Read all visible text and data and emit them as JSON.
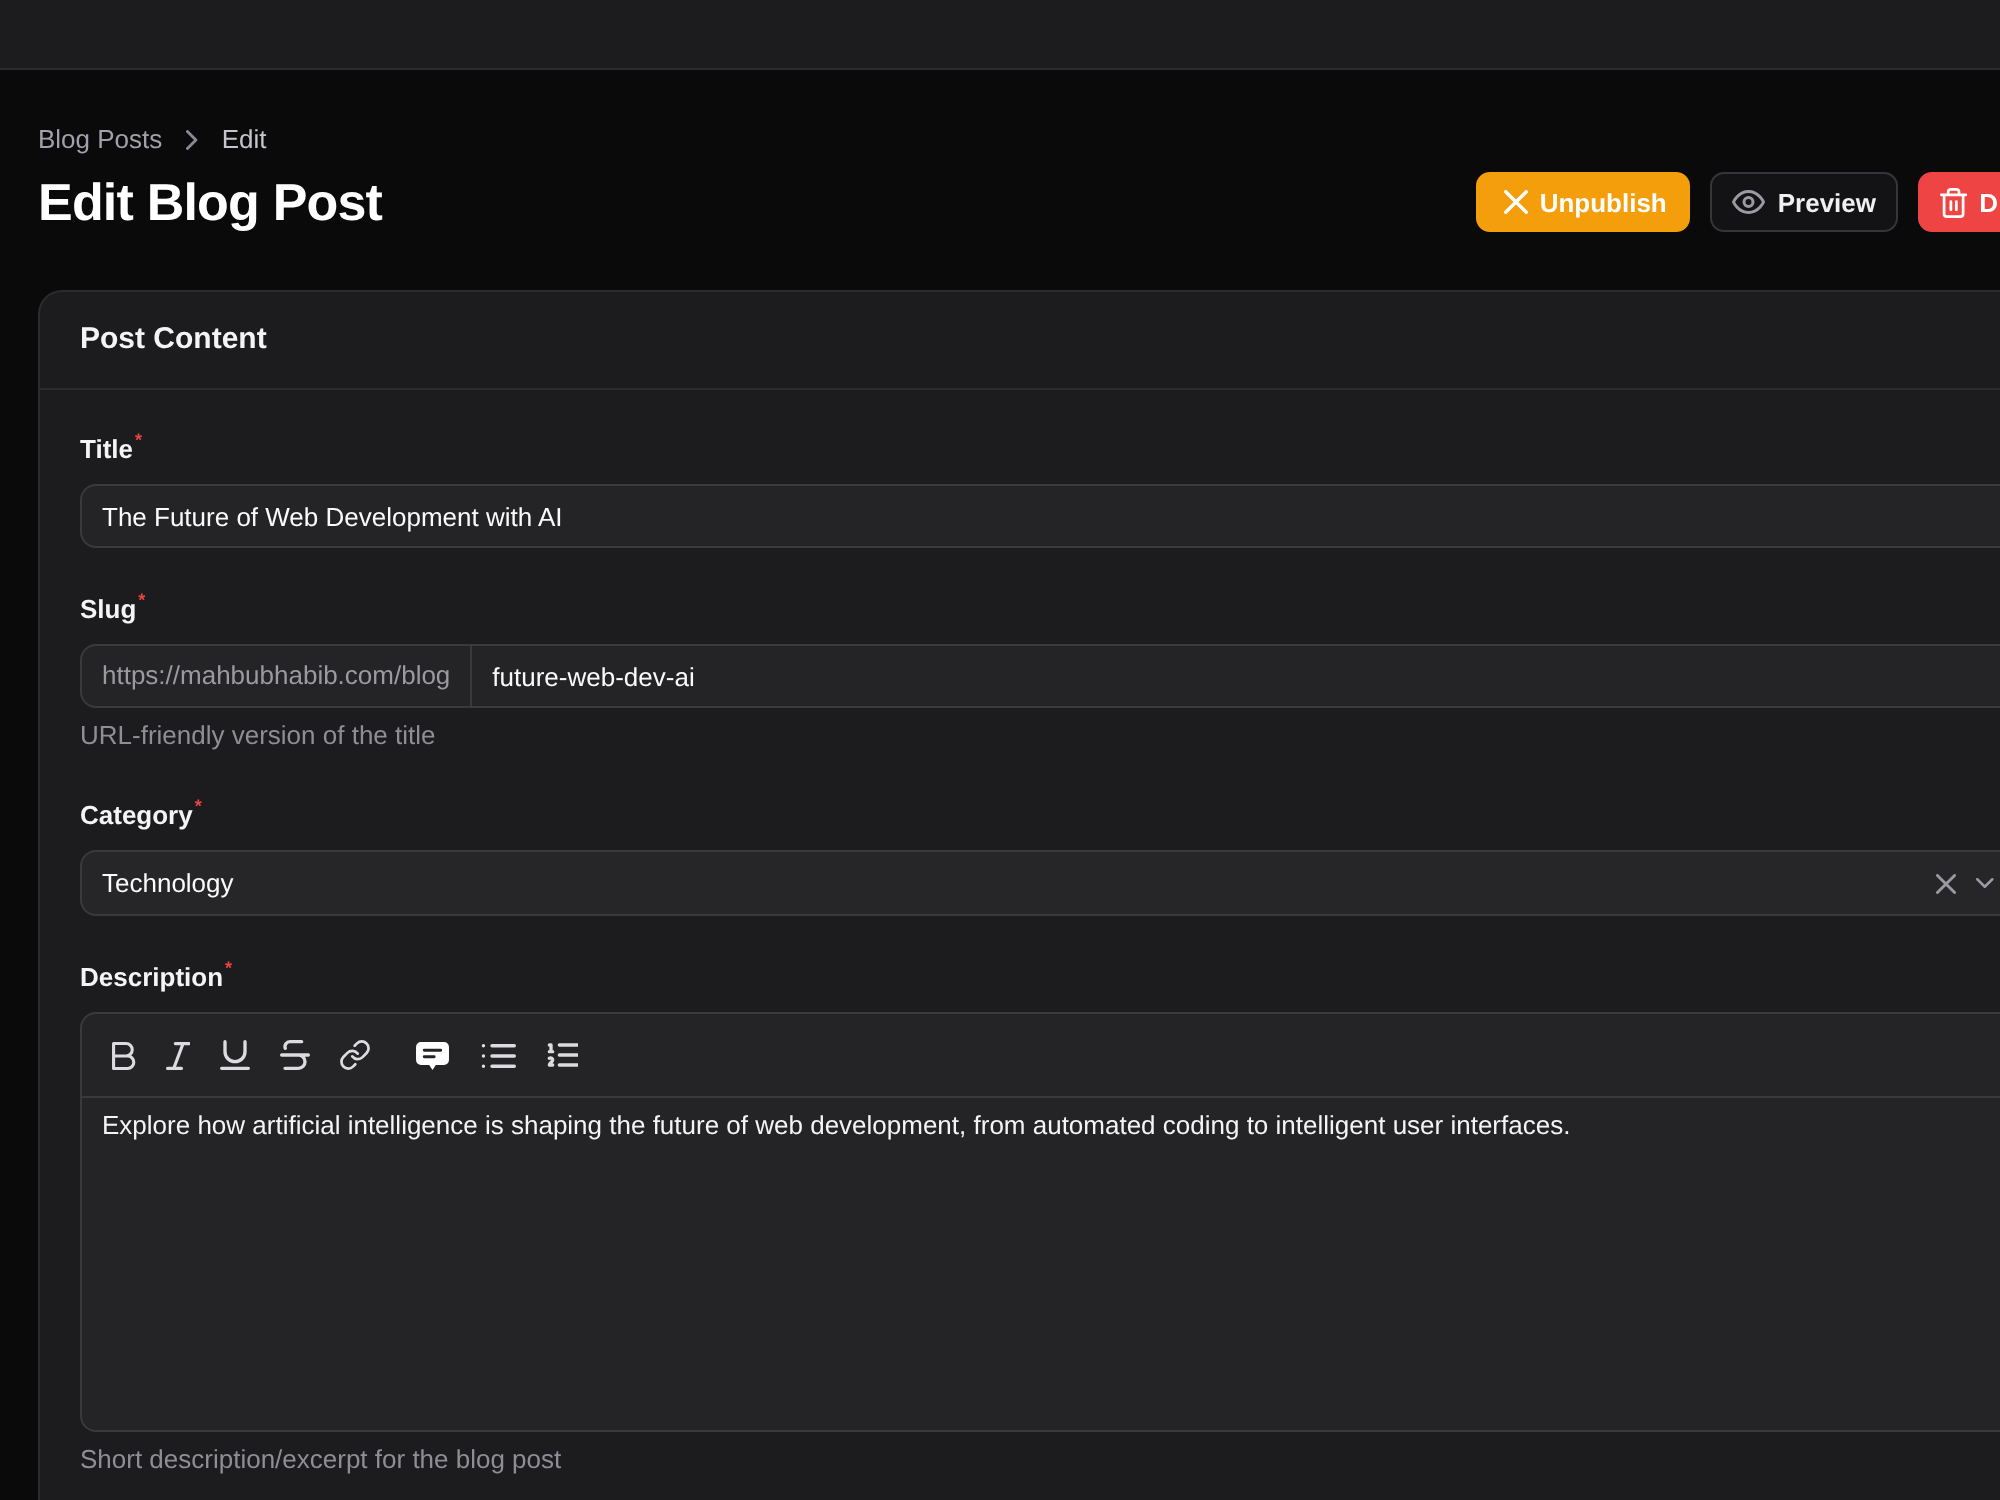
{
  "breadcrumbs": [
    {
      "label": "Blog Posts",
      "current": false
    },
    {
      "label": "Edit",
      "current": true
    }
  ],
  "page_title": "Edit Blog Post",
  "actions": [
    {
      "label": "Unpublish",
      "kind": "warning"
    },
    {
      "label": "Preview",
      "kind": "secondary"
    },
    {
      "label": "D",
      "kind": "danger"
    }
  ],
  "card": {
    "title": "Post Content",
    "fields": [
      {
        "kind": "text",
        "label": "Title$^{*}$",
        "value": "The Future of Web Development with AI"
      },
      {
        "kind": "prefixed",
        "label": "Slug$^{*}$",
        "prefix": "https://mahbubhabib.com/blog",
        "value": "future-web-dev-ai",
        "help": "URL-friendly version of the title"
      },
      {
        "kind": "select",
        "label": "Category$^{*}$",
        "value": "Technology",
        "clearable": true
      },
      {
        "kind": "editor",
        "label": "Description$^{*}$",
        "value": "Explore how artificial intelligence is shaping the future of web development, from automated coding to intelligent user interfaces.",
        "help": "Short description/excerpt for the blog post"
      }
    ]
  }
}
